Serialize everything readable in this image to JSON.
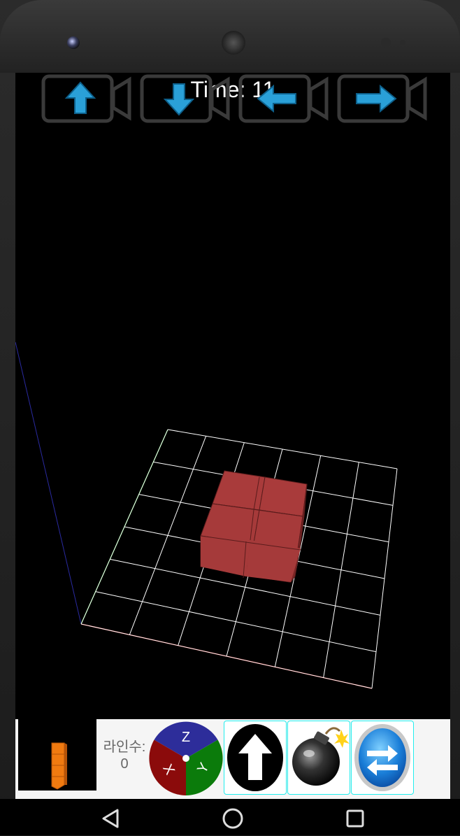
{
  "header": {
    "time_label": "Time: 11"
  },
  "direction_buttons": [
    {
      "direction": "up",
      "icon": "arrow-up-icon"
    },
    {
      "direction": "down",
      "icon": "arrow-down-icon"
    },
    {
      "direction": "left",
      "icon": "arrow-left-icon"
    },
    {
      "direction": "right",
      "icon": "arrow-right-icon"
    }
  ],
  "bottom_panel": {
    "lines_label": "라인수:",
    "lines_value": "0",
    "rotation_wheel": {
      "z_label": "Z",
      "y_label": "Y",
      "x_label": "X",
      "colors": {
        "z": "#2b2b9e",
        "y": "#0a7a0a",
        "x": "#8a0a0a"
      }
    },
    "tools": [
      {
        "name": "drop",
        "icon": "up-arrow-icon"
      },
      {
        "name": "bomb",
        "icon": "bomb-icon"
      },
      {
        "name": "swap",
        "icon": "swap-arrows-icon"
      }
    ]
  },
  "board": {
    "block_color": "#a83a3a",
    "next_piece_color": "#f07a10"
  },
  "nav_bar": {
    "back": "back-icon",
    "home": "home-icon",
    "recents": "recents-icon"
  }
}
